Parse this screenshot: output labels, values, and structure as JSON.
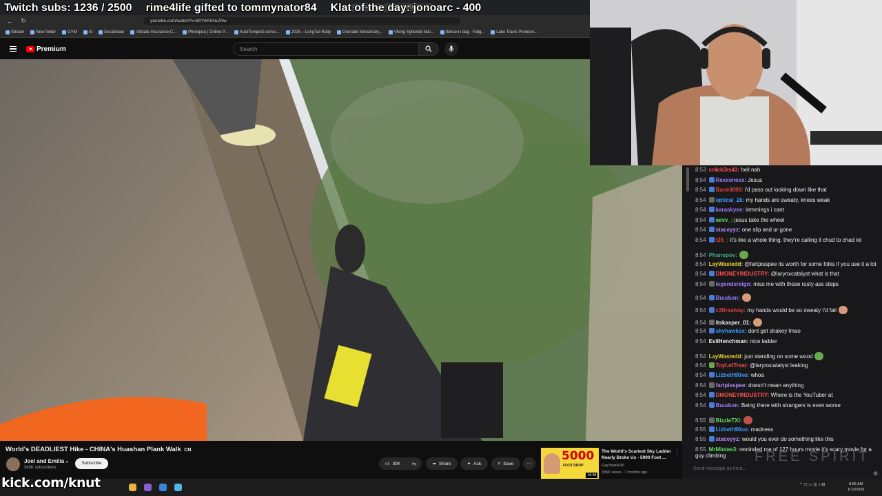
{
  "overlay": {
    "subs": "Twitch subs: 1236 / 2500",
    "gifted": "rime4life gifted to tommynator84",
    "klat": "Klat of the day: jonoarc - 400"
  },
  "browser": {
    "tabs": [
      "Airplane food",
      "DEADLIEST Hike - Ch"
    ],
    "url": "youtube.com/watch?v=80Y6R04eZRw",
    "bookmarks": [
      "Stream",
      "New folder",
      "GYM",
      "AI",
      "Excalidraw",
      "Allstate Insurance C...",
      "Photopea | Online P...",
      "AutoTempest.com:c...",
      "2025 – LongTail Rally",
      "Grenade Mercenary...",
      "Viking Syttende Mai...",
      "Børsen i dag - Følg...",
      "Lake Travis Pontoon..."
    ]
  },
  "youtube": {
    "logo": "Premium",
    "search_placeholder": "Search",
    "video_title": "World's DEADLIEST Hike - CHINA's Huashan Plank Walk",
    "country_suffix": "CN",
    "channel": "Joel and Emilia",
    "subscribers": "343K subscribers",
    "subscribe": "Subscribe",
    "likes": "30K",
    "share": "Share",
    "ask": "Ask",
    "save": "Save",
    "rec": {
      "thumb_big": "5000",
      "thumb_small": "FOOT DROP",
      "duration": "16:48",
      "title": "The World's Scariest Sky Ladder Nearly Broke Us - 5000 Foot ...",
      "channel": "GapYearAt30",
      "meta": "305K views · 7 months ago"
    }
  },
  "chat": {
    "messages": [
      {
        "ts": "8:53",
        "user": "cr4ck3rs43:",
        "color": "#ff4f4f",
        "text": " hell nah",
        "badge": "",
        "emote": ""
      },
      {
        "ts": "8:54",
        "user": "Rexxenexx:",
        "color": "#9d7cff",
        "text": " Jesus",
        "badge": "#4b7bd8",
        "emote": ""
      },
      {
        "ts": "8:54",
        "user": "Baneil090:",
        "color": "#e0403c",
        "text": " i'd pass out looking down like that",
        "badge": "#4b7bd8",
        "emote": ""
      },
      {
        "ts": "8:54",
        "user": "optical_2k:",
        "color": "#3b9cff",
        "text": " my hands are sweaty, knees weak",
        "badge": "#6a6a6a",
        "emote": ""
      },
      {
        "ts": "8:54",
        "user": "karaskyee:",
        "color": "#9d7cff",
        "text": " lemmings i cant",
        "badge": "#4b7bd8",
        "emote": ""
      },
      {
        "ts": "8:54",
        "user": "aevv_:",
        "color": "#5ee05e",
        "text": " jesus take the wheel",
        "badge": "#4b7bd8",
        "emote": ""
      },
      {
        "ts": "8:54",
        "user": "staceyyz:",
        "color": "#b98aff",
        "text": " one slip and ur gone",
        "badge": "#4b7bd8",
        "emote": ""
      },
      {
        "ts": "8:54",
        "user": "t26_:",
        "color": "#e0403c",
        "text": " it's like a whole thing. they're calling it chud to chad lol",
        "badge": "#4b7bd8",
        "emote": ""
      },
      {
        "ts": "8:54",
        "user": "Phanopov:",
        "color": "#3fae74",
        "text": "",
        "badge": "",
        "emote": "#6aa84f"
      },
      {
        "ts": "8:54",
        "user": "LayWastedd:",
        "color": "#e8d33a",
        "text": " @fartpisspee its worth for some folks if you use it a lot",
        "badge": "",
        "emote": ""
      },
      {
        "ts": "8:54",
        "user": "DMONEYINDUSTRY:",
        "color": "#ff4f4f",
        "text": " @larynxcatalyst what is that",
        "badge": "#4b7bd8",
        "emote": ""
      },
      {
        "ts": "8:54",
        "user": "legendsreign:",
        "color": "#9d7cff",
        "text": " miss me with those rusty ass steps",
        "badge": "#6a6a6a",
        "emote": ""
      },
      {
        "ts": "8:54",
        "user": "Buudum:",
        "color": "#9d7cff",
        "text": "",
        "badge": "#4b7bd8",
        "emote": "#d59b7a"
      },
      {
        "ts": "8:54",
        "user": "c3fireaway:",
        "color": "#e0403c",
        "text": " my hands would be so sweaty I'd fall",
        "badge": "#4b7bd8",
        "emote": "#d59b7a"
      },
      {
        "ts": "8:54",
        "user": "itskasper_01:",
        "color": "#efeff1",
        "text": "",
        "badge": "#6a6a6a",
        "emote": "#d59b7a"
      },
      {
        "ts": "8:54",
        "user": "skyhawksx:",
        "color": "#3b9cff",
        "text": " dont get shakey lmao",
        "badge": "#4b7bd8",
        "emote": ""
      },
      {
        "ts": "8:54",
        "user": "EvilHenchman:",
        "color": "#efeff1",
        "text": " nice ladder",
        "badge": "",
        "emote": ""
      },
      {
        "ts": "8:54",
        "user": "LayWastedd:",
        "color": "#e8d33a",
        "text": " just standing on some wood",
        "badge": "",
        "emote": "#6aa84f"
      },
      {
        "ts": "8:54",
        "user": "ToyLetTreat:",
        "color": "#ff4f4f",
        "text": " @larynxcatalyst leaking",
        "badge": "#6aa84f",
        "emote": ""
      },
      {
        "ts": "8:54",
        "user": "Lizbeth90xo:",
        "color": "#3b9cff",
        "text": " whoa",
        "badge": "#4b7bd8",
        "emote": ""
      },
      {
        "ts": "8:54",
        "user": "fartpisspee:",
        "color": "#b98aff",
        "text": " doesn't mean anything",
        "badge": "#6a6a6a",
        "emote": ""
      },
      {
        "ts": "8:54",
        "user": "DMONEYINDUSTRY:",
        "color": "#ff4f4f",
        "text": " Where is the YouTuber at",
        "badge": "#4b7bd8",
        "emote": ""
      },
      {
        "ts": "8:54",
        "user": "Buudum:",
        "color": "#9d7cff",
        "text": " Being there with strangers is even worse",
        "badge": "#4b7bd8",
        "emote": ""
      },
      {
        "ts": "8:55",
        "user": "BizzleTXI:",
        "color": "#5ee05e",
        "text": "",
        "badge": "#6a6a6a",
        "emote": "#c0504d"
      },
      {
        "ts": "8:55",
        "user": "Lizbeth90xo:",
        "color": "#3b9cff",
        "text": " madness",
        "badge": "#4b7bd8",
        "emote": ""
      },
      {
        "ts": "8:55",
        "user": "staceyyz:",
        "color": "#b98aff",
        "text": " would you ever do something like this",
        "badge": "#4b7bd8",
        "emote": ""
      },
      {
        "ts": "8:55",
        "user": "MrMintee3:",
        "color": "#5ee05e",
        "text": " reminded me of 127 hours movie it's scary movie for a",
        "badge": "",
        "emote": ""
      }
    ],
    "wrap_line": "guy climbing",
    "input_placeholder": "Send message as knut...",
    "watermark": "FREE SPIRIT"
  },
  "taskbar": {
    "kick": "kick.com/knut",
    "time": "8:55 AM",
    "date": "1/12/2026"
  },
  "colors": {
    "youtube_red": "#ff0000",
    "chat_bg": "#18181b",
    "page_bg": "#0f0f0f"
  },
  "icons": [
    "menu-icon",
    "search-icon",
    "mic-icon",
    "like-icon",
    "dislike-icon",
    "share-icon",
    "ask-icon",
    "save-icon",
    "more-icon",
    "verified-icon"
  ]
}
